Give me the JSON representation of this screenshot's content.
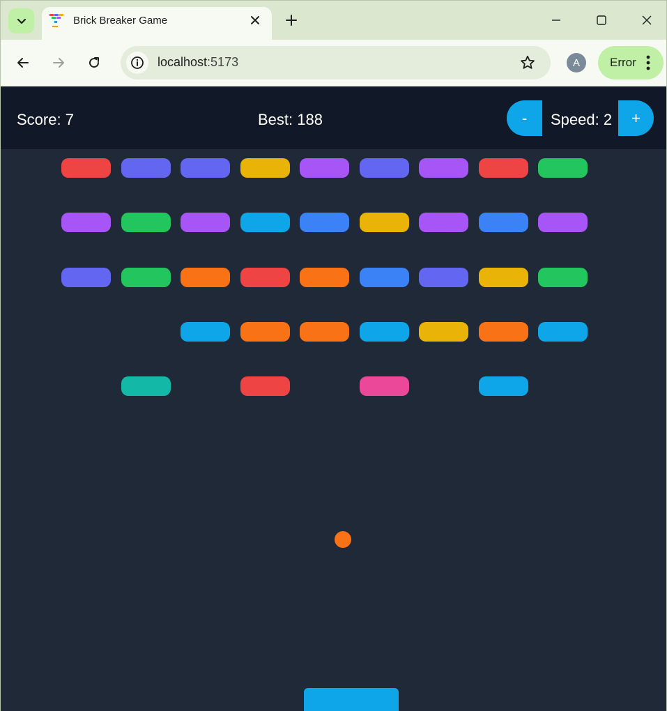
{
  "browser": {
    "tab_title": "Brick Breaker Game",
    "url_host": "localhost",
    "url_port": ":5173",
    "profile_initial": "A",
    "error_label": "Error"
  },
  "hud": {
    "score_label": "Score: 7",
    "best_label": "Best: 188",
    "speed_label": "Speed: 2",
    "speed_down_label": "-",
    "speed_up_label": "+"
  },
  "game": {
    "score": 7,
    "best": 188,
    "speed": 2,
    "brick_columns": 9,
    "brick_rows": [
      [
        "#ef4444",
        "#6366f1",
        "#6366f1",
        "#eab308",
        "#a855f7",
        "#6366f1",
        "#a855f7",
        "#ef4444",
        "#22c55e"
      ],
      [
        "#a855f7",
        "#22c55e",
        "#a855f7",
        "#0ea5e9",
        "#3b82f6",
        "#eab308",
        "#a855f7",
        "#3b82f6",
        "#a855f7"
      ],
      [
        "#6366f1",
        "#22c55e",
        "#f97316",
        "#ef4444",
        "#f97316",
        "#3b82f6",
        "#6366f1",
        "#eab308",
        "#22c55e"
      ],
      [
        null,
        null,
        "#0ea5e9",
        "#f97316",
        "#f97316",
        "#0ea5e9",
        "#eab308",
        "#f97316",
        "#0ea5e9"
      ],
      [
        null,
        "#14b8a6",
        null,
        "#ef4444",
        null,
        "#ec4899",
        null,
        "#0ea5e9",
        null
      ]
    ],
    "ball_color": "#f97316",
    "paddle_color": "#0ea5e9"
  },
  "colors": {
    "page_background": "#1f2937",
    "hud_background": "#111827",
    "accent": "#0ea5e9"
  }
}
